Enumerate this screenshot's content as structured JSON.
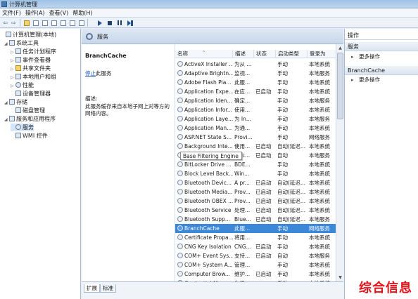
{
  "window": {
    "title": "计算机管理"
  },
  "menu": [
    "文件(F)",
    "操作(A)",
    "查看(V)",
    "帮助(H)"
  ],
  "tree": [
    {
      "label": "计算机管理(本地)",
      "level": 0,
      "expander": ""
    },
    {
      "label": "系统工具",
      "level": 1,
      "expander": "◢"
    },
    {
      "label": "任务计划程序",
      "level": 2,
      "expander": "▷"
    },
    {
      "label": "事件查看器",
      "level": 2,
      "expander": "▷"
    },
    {
      "label": "共享文件夹",
      "level": 2,
      "expander": "▷"
    },
    {
      "label": "本地用户和组",
      "level": 2,
      "expander": "▷"
    },
    {
      "label": "性能",
      "level": 2,
      "expander": "▷"
    },
    {
      "label": "设备管理器",
      "level": 2,
      "expander": ""
    },
    {
      "label": "存储",
      "level": 1,
      "expander": "◢"
    },
    {
      "label": "磁盘管理",
      "level": 2,
      "expander": ""
    },
    {
      "label": "服务和应用程序",
      "level": 1,
      "expander": "◢"
    },
    {
      "label": "服务",
      "level": 2,
      "expander": "",
      "selected": true
    },
    {
      "label": "WMI 控件",
      "level": 2,
      "expander": ""
    }
  ],
  "panel": {
    "title": "服务"
  },
  "detail": {
    "service_name": "BranchCache",
    "stop_link": "停止",
    "stop_suffix": "此服务",
    "desc_label": "描述:",
    "description": "此服务缓存来自本地子网上对等方的网络内容。"
  },
  "columns": [
    "名称",
    "描述",
    "状态",
    "启动类型",
    "登录为"
  ],
  "services": [
    {
      "name": "ActiveX Installer ...",
      "desc": "为从 ...",
      "status": "",
      "startup": "手动",
      "logon": "本地系统"
    },
    {
      "name": "Adaptive Brightn...",
      "desc": "监视...",
      "status": "",
      "startup": "手动",
      "logon": "本地服务"
    },
    {
      "name": "Adobe Flash Pla...",
      "desc": "此服...",
      "status": "",
      "startup": "手动",
      "logon": "本地系统"
    },
    {
      "name": "Application Expe...",
      "desc": "在应...",
      "status": "已启动",
      "startup": "手动",
      "logon": "本地系统"
    },
    {
      "name": "Application Iden...",
      "desc": "确定...",
      "status": "",
      "startup": "手动",
      "logon": "本地服务"
    },
    {
      "name": "Application Infor...",
      "desc": "使用...",
      "status": "",
      "startup": "手动",
      "logon": "本地系统"
    },
    {
      "name": "Application Laye...",
      "desc": "为 In...",
      "status": "",
      "startup": "手动",
      "logon": "本地服务"
    },
    {
      "name": "Application Man...",
      "desc": "为通...",
      "status": "",
      "startup": "手动",
      "logon": "本地系统"
    },
    {
      "name": "ASP.NET State S...",
      "desc": "Provi...",
      "status": "",
      "startup": "手动",
      "logon": "网络服务"
    },
    {
      "name": "Background Inte...",
      "desc": "使用...",
      "status": "已启动",
      "startup": "自动(延迟...",
      "logon": "本地系统"
    },
    {
      "name": "Base Filtering Engine",
      "desc": "基本...",
      "status": "已启动",
      "startup": "自动",
      "logon": "本地服务"
    },
    {
      "name": "BitLocker Drive ...",
      "desc": "BDE...",
      "status": "",
      "startup": "手动",
      "logon": "本地系统"
    },
    {
      "name": "Block Level Back...",
      "desc": "Win...",
      "status": "",
      "startup": "手动",
      "logon": "本地系统"
    },
    {
      "name": "Bluetooth Devic...",
      "desc": "A pr...",
      "status": "已启动",
      "startup": "自动(延迟...",
      "logon": "本地系统"
    },
    {
      "name": "Bluetooth Media...",
      "desc": "Prov...",
      "status": "已启动",
      "startup": "自动(延迟...",
      "logon": "本地系统"
    },
    {
      "name": "Bluetooth OBEX ...",
      "desc": "Prov...",
      "status": "已启动",
      "startup": "自动(延迟...",
      "logon": "本地系统"
    },
    {
      "name": "Bluetooth Service",
      "desc": "处理...",
      "status": "已启动",
      "startup": "自动(延迟...",
      "logon": "本地系统"
    },
    {
      "name": "Bluetooth Supp...",
      "desc": "Blue...",
      "status": "已启动",
      "startup": "自动(延迟...",
      "logon": "本地服务"
    },
    {
      "name": "BranchCache",
      "desc": "此服...",
      "status": "",
      "startup": "手动",
      "logon": "网络服务",
      "selected": true
    },
    {
      "name": "Certificate Propa...",
      "desc": "将用...",
      "status": "",
      "startup": "手动",
      "logon": "本地系统"
    },
    {
      "name": "CNG Key Isolation",
      "desc": "CNG...",
      "status": "已启动",
      "startup": "手动",
      "logon": "本地系统"
    },
    {
      "name": "COM+ Event Sys...",
      "desc": "支持...",
      "status": "已启动",
      "startup": "自动",
      "logon": "本地服务"
    },
    {
      "name": "COM+ System A...",
      "desc": "管理...",
      "status": "",
      "startup": "手动",
      "logon": "本地系统"
    },
    {
      "name": "Computer Brow...",
      "desc": "维护...",
      "status": "已启动",
      "startup": "手动",
      "logon": "本地系统"
    },
    {
      "name": "Credential Mana...",
      "desc": "为用...",
      "status": "",
      "startup": "手动",
      "logon": "本地系统"
    }
  ],
  "tooltip": "Base Filtering Engine",
  "bottom_tabs": [
    "扩展",
    "标准"
  ],
  "actions": {
    "header1": "操作",
    "section1": "服务",
    "more1": "更多操作",
    "section2": "BranchCache",
    "more2": "更多操作"
  },
  "watermark": "综合信息"
}
